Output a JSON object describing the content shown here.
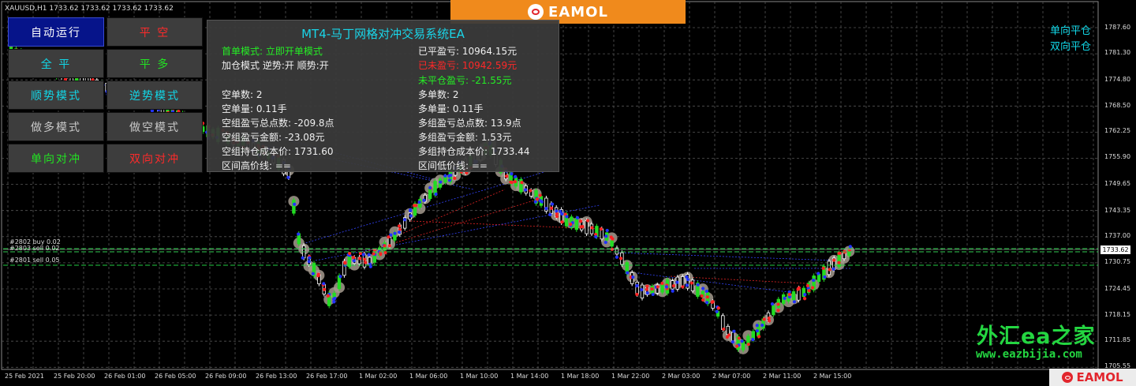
{
  "chart": {
    "symbol_line": "XAUUSD,H1  1733.62 1733.62 1733.62 1733.62",
    "price_ticks": [
      "1787.60",
      "1781.30",
      "1774.80",
      "1768.50",
      "1762.25",
      "1755.90",
      "1749.65",
      "1743.35",
      "1737.00",
      "1730.75",
      "1724.45",
      "1718.15",
      "1711.85",
      "1705.55"
    ],
    "current_price": "1733.62",
    "time_ticks": [
      "25 Feb 2021",
      "25 Feb 20:00",
      "26 Feb 01:00",
      "26 Feb 05:00",
      "26 Feb 09:00",
      "26 Feb 13:00",
      "26 Feb 17:00",
      "1 Mar 02:00",
      "1 Mar 06:00",
      "1 Mar 10:00",
      "1 Mar 14:00",
      "1 Mar 18:00",
      "1 Mar 22:00",
      "2 Mar 03:00",
      "2 Mar 07:00",
      "2 Mar 11:00",
      "2 Mar 15:00"
    ],
    "order_labels": [
      "#2802 buy 0.02",
      "#2803 sell 0.02",
      "#2801 sell 0.05"
    ],
    "colors": {
      "grid": "#555555",
      "candle_up": "#22dd22",
      "candle_down": "#ffffff",
      "buy_marker": "#2233ff",
      "sell_marker": "#ff2222",
      "halo": "#a59a8e",
      "level_line": "#22cc44",
      "buy_dash": "#3344ff",
      "sell_dash": "#dd2222"
    }
  },
  "branding": {
    "top_logo_text": "EAMOL",
    "bottom_logo_text": "EAMOL",
    "watermark_text": "外汇ea之家",
    "watermark_url": "www.eazbijia.com"
  },
  "controls": {
    "auto_run": "自动运行",
    "close_short": "平  空",
    "close_all": "全  平",
    "close_long": "平  多",
    "trend_mode": "顺势模式",
    "counter_mode": "逆势模式",
    "long_mode": "做多模式",
    "short_mode": "做空模式",
    "single_hedge": "单向对冲",
    "double_hedge": "双向对冲"
  },
  "panel": {
    "title": "MT4-马丁网格对冲交易系统EA",
    "first_mode": "首单模式: 立即开单模式",
    "add_mode": "加仓模式 逆势:开 顺势:开",
    "short_count": "空单数: 2",
    "short_lots": "空单量: 0.11手",
    "short_group_points": "空组盈亏总点数: -209.8点",
    "short_group_amount": "空组盈亏金额: -23.08元",
    "short_group_cost": "空组持仓成本价: 1731.60",
    "range_high": "区间高价线: ==",
    "closed_profit": "已平盈亏: 10964.15元",
    "loss_total": "已未盈亏: 10942.59元",
    "unclosed_profit": "未平仓盈亏: -21.55元",
    "long_count": "多单数: 2",
    "long_lots": "多单量: 0.11手",
    "long_group_points": "多组盈亏总点数: 13.9点",
    "long_group_amount": "多组盈亏金额: 1.53元",
    "long_group_cost": "多组持仓成本价: 1733.44",
    "range_low": "区间低价线: =="
  },
  "right_labels": {
    "single_close": "单向平仓",
    "double_close": "双向平仓"
  }
}
